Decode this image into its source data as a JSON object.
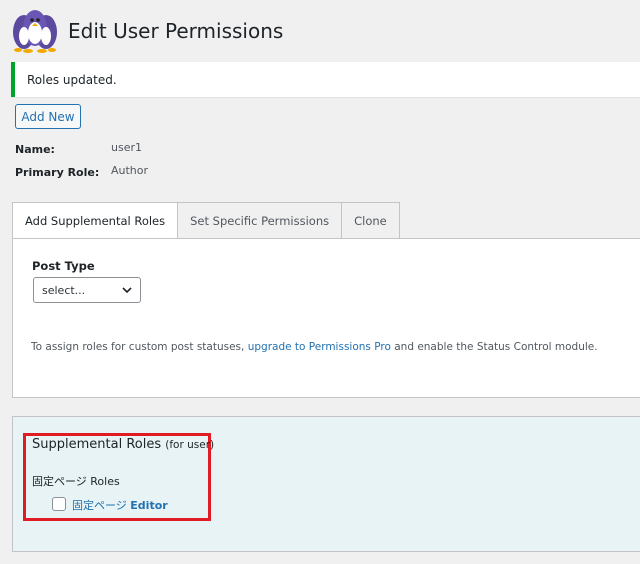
{
  "header": {
    "title": "Edit User Permissions",
    "logo_icon": "penguins-logo-icon"
  },
  "notice": {
    "text": "Roles updated.",
    "accent_color": "#00a32a"
  },
  "actions": {
    "add_new_label": "Add New"
  },
  "user": {
    "name_label": "Name:",
    "name_value": "user1",
    "role_label": "Primary Role:",
    "role_value": "Author"
  },
  "tabs": [
    {
      "label": "Add Supplemental Roles",
      "active": true
    },
    {
      "label": "Set Specific Permissions",
      "active": false
    },
    {
      "label": "Clone",
      "active": false
    }
  ],
  "post_type": {
    "label": "Post Type",
    "selected": "select...",
    "icon": "chevron-down-icon"
  },
  "upsell": {
    "before": "To assign roles for custom post statuses, ",
    "link_text": "upgrade to Permissions Pro",
    "after": " and enable the Status Control module."
  },
  "supplemental": {
    "title": "Supplemental Roles",
    "title_suffix": "(for user)",
    "group_label": "固定ページ Roles",
    "role_prefix": "固定ページ",
    "role_name": "Editor",
    "checked": false,
    "highlight_color": "#e01b24"
  }
}
